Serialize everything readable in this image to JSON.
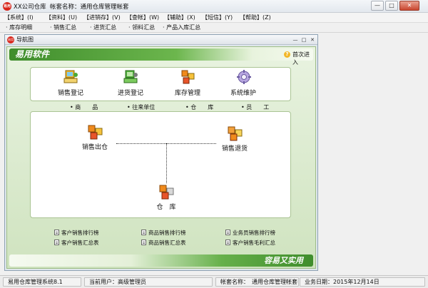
{
  "window": {
    "app_badge": "易用",
    "title": "XX公司仓库",
    "account_label": "帐套名称：通用仓库管理帐套",
    "buttons": {
      "minimize": "—",
      "maximize": "□",
      "close": "✕"
    }
  },
  "menu": [
    {
      "label": "【系统】(I)"
    },
    {
      "label": "【资料】(U)"
    },
    {
      "label": "【进销存】(V)"
    },
    {
      "label": "【查帐】(W)"
    },
    {
      "label": "【辅助】(X)"
    },
    {
      "label": "【短信】(Y)"
    },
    {
      "label": "【帮助】(Z)"
    }
  ],
  "toolbar": [
    {
      "label": "· 库存明细"
    },
    {
      "label": "· 销售汇总"
    },
    {
      "label": "· 进货汇总"
    },
    {
      "label": "· 领料汇总"
    },
    {
      "label": "· 产品入库汇总"
    }
  ],
  "nav_window": {
    "badge": "易用",
    "title": "导航图",
    "buttons": {
      "minimize": "—",
      "maximize": "□",
      "close": "✕"
    },
    "brand": "易用软件",
    "help_icon": "?",
    "help_label": "首次进入",
    "modules": [
      {
        "label": "销售登记",
        "icon": "sales-register-icon",
        "sub": "• 商　　品"
      },
      {
        "label": "进货登记",
        "icon": "purchase-register-icon",
        "sub": "• 往来单位"
      },
      {
        "label": "库存管理",
        "icon": "inventory-icon",
        "sub": "• 仓　　库"
      },
      {
        "label": "系统维护",
        "icon": "gear-icon",
        "sub": "• 员　　工"
      }
    ],
    "flow": {
      "sales_out": "销售出仓",
      "sales_return": "销售退货",
      "warehouse": "仓　库"
    },
    "reports": [
      {
        "label": "客户销售排行榜"
      },
      {
        "label": "商品销售排行榜"
      },
      {
        "label": "业务员销售排行榜"
      },
      {
        "label": "客户销售汇总表"
      },
      {
        "label": "商品销售汇总表"
      },
      {
        "label": "客户销售毛利汇总"
      }
    ],
    "slogan": "容易又实用"
  },
  "status": {
    "system": "易用仓库管理系统8.1",
    "user": "当前用户：高级管理员",
    "account": "帐套名称：　通用仓库管理帐套",
    "date": "业务日期：2015年12月14日"
  },
  "colors": {
    "brand_green": "#3f8d2c",
    "panel_green": "#cfe3bf",
    "accent_red": "#d8261b"
  }
}
